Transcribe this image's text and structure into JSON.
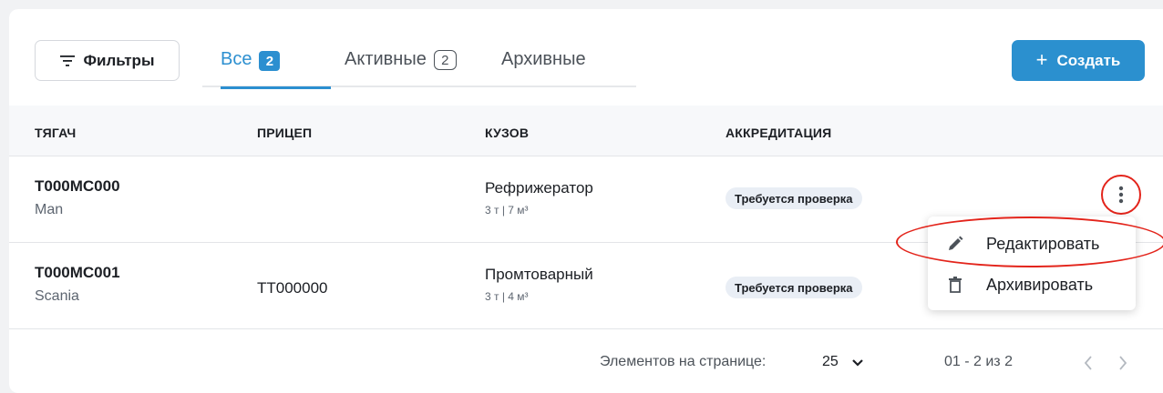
{
  "toolbar": {
    "filters_label": "Фильтры",
    "create_label": "Создать",
    "create_icon": "+",
    "tabs": [
      {
        "label": "Все",
        "count": "2",
        "active": true
      },
      {
        "label": "Активные",
        "count": "2",
        "active": false
      },
      {
        "label": "Архивные",
        "active": false
      }
    ]
  },
  "table": {
    "columns": [
      "ТЯГАЧ",
      "ПРИЦЕП",
      "КУЗОВ",
      "АККРЕДИТАЦИЯ"
    ],
    "rows": [
      {
        "tractor_number": "Т000МС000",
        "tractor_brand": "Man",
        "trailer": "",
        "body_type": "Рефрижератор",
        "body_specs": "3 т | 7 м³",
        "accreditation": "Требуется проверка"
      },
      {
        "tractor_number": "Т000МС001",
        "tractor_brand": "Scania",
        "trailer": "ТТ000000",
        "body_type": "Промтоварный",
        "body_specs": "3 т | 4 м³",
        "accreditation": "Требуется проверка"
      }
    ]
  },
  "row_menu": {
    "items": [
      {
        "label": "Редактировать",
        "icon": "pencil-icon"
      },
      {
        "label": "Архивировать",
        "icon": "trash-icon"
      }
    ]
  },
  "pagination": {
    "per_page_label": "Элементов на странице:",
    "per_page_value": "25",
    "range_text": "01 - 2 из 2"
  },
  "colors": {
    "accent": "#2c8fd0",
    "annotation": "#e3241b",
    "status_bg": "#e9eef5"
  }
}
